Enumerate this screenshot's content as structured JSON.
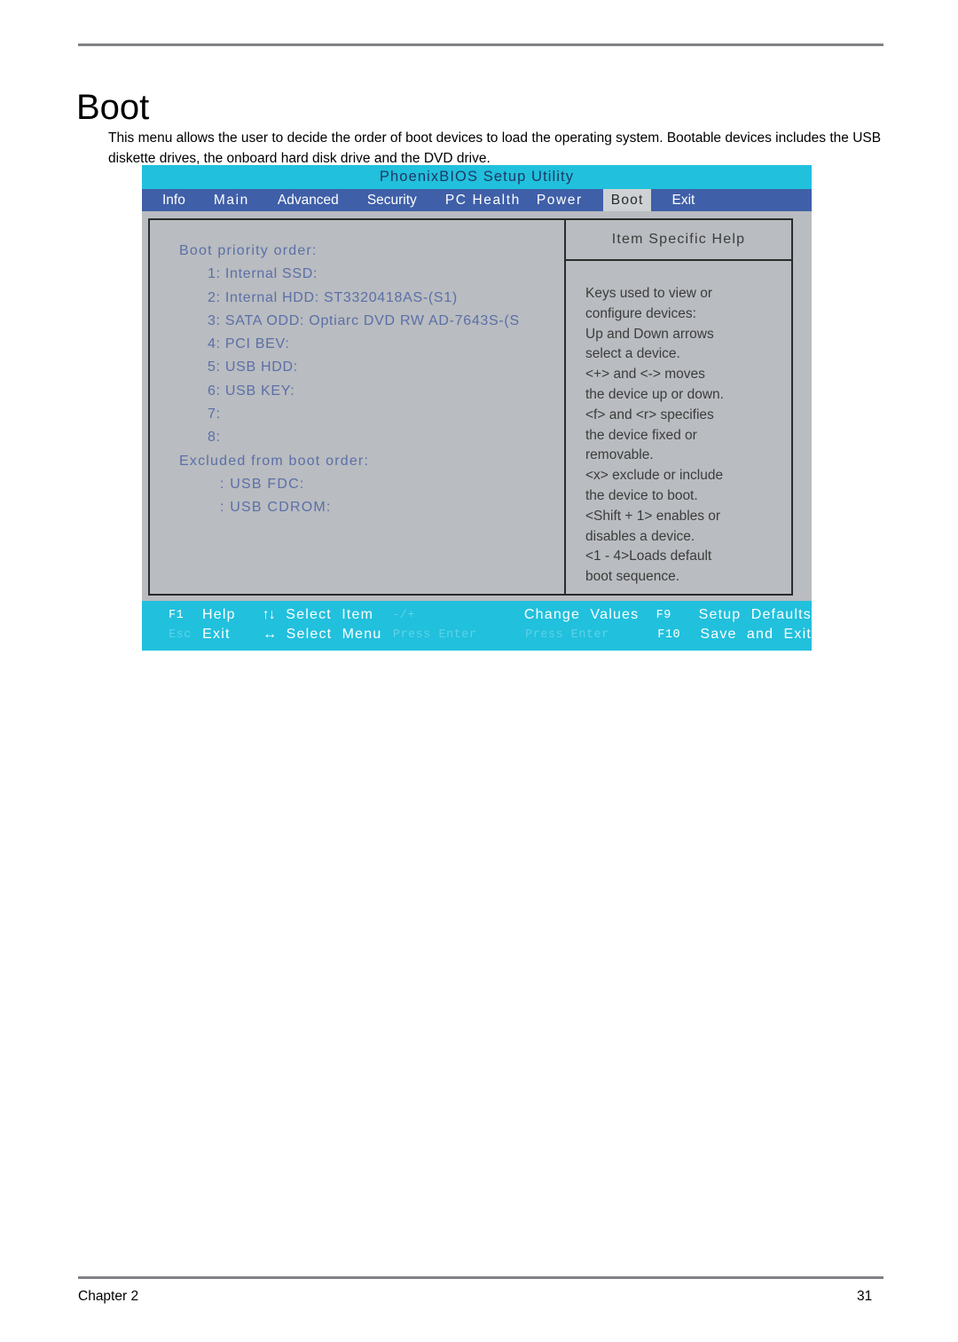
{
  "document": {
    "title": "Boot",
    "intro": "This menu allows the user to decide the order of boot devices to load the operating system. Bootable devices includes the USB diskette drives, the onboard hard disk drive and the DVD drive.",
    "footer": {
      "chapter": "Chapter 2",
      "page_number": "31"
    }
  },
  "bios": {
    "title": "PhoenixBIOS Setup Utility",
    "colors": {
      "title_bar": "#21c0dd",
      "menu_bar": "#3f5fa8",
      "panel_bg": "#b9bcc0",
      "active_tab_bg": "#cfd2d4",
      "list_text": "#5b6fa8",
      "help_text": "#3c3c3c"
    },
    "tabs": [
      {
        "label": "Info",
        "active": false
      },
      {
        "label": "Main",
        "active": false
      },
      {
        "label": "Advanced",
        "active": false
      },
      {
        "label": "Security",
        "active": false
      },
      {
        "label": "PC Health",
        "active": false
      },
      {
        "label": "Power",
        "active": false
      },
      {
        "label": "Boot",
        "active": true
      },
      {
        "label": "Exit",
        "active": false
      }
    ],
    "boot_priority": {
      "heading": "Boot priority order:",
      "items": [
        "1: Internal SSD:",
        "2: Internal HDD: ST3320418AS-(S1)",
        "3: SATA ODD: Optiarc DVD RW AD-7643S-(S",
        "4: PCI BEV:",
        "5: USB HDD:",
        "6: USB KEY:",
        "7:",
        "8:"
      ]
    },
    "excluded": {
      "heading": "Excluded from boot order:",
      "items": [
        ": USB FDC:",
        ": USB CDROM:"
      ]
    },
    "help": {
      "title": "Item Specific Help",
      "lines": [
        "Keys used to view or",
        "configure devices:",
        "Up and Down arrows",
        "select a device.",
        "<+> and <-> moves",
        "the device up or down.",
        "<f> and <r> specifies",
        "the device fixed or",
        "removable.",
        "<x> exclude or include",
        "the device to boot.",
        "<Shift + 1> enables or",
        "disables a device.",
        "<1 - 4>Loads default",
        "boot sequence."
      ]
    },
    "keybar": {
      "row1": {
        "k1": "F1",
        "l1": "Help",
        "arrows": "↑↓",
        "l2": "Select  Item",
        "k3": "-/+",
        "l3": "Change  Values",
        "k4": "F9",
        "l4": "Setup  Defaults"
      },
      "row2": {
        "k1": "Esc",
        "l1": "Exit",
        "arrows": "↔",
        "l2": "Select  Menu",
        "k3": "Press  Enter",
        "l3": "Press  Enter",
        "k4": "F10",
        "l4": "Save  and  Exit"
      }
    }
  }
}
